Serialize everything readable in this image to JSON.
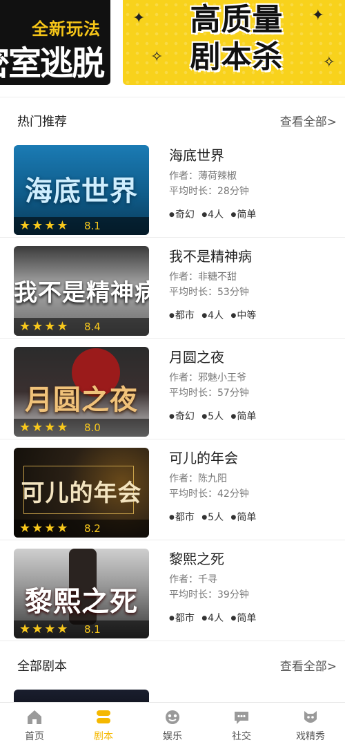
{
  "banners": {
    "left": {
      "line1": "全新玩法",
      "line2": "密室逃脱"
    },
    "right": {
      "line1": "高质量",
      "line2": "剧本杀"
    }
  },
  "sections": {
    "hot": {
      "title": "热门推荐",
      "more": "查看全部>"
    },
    "all": {
      "title": "全部剧本",
      "more": "查看全部>"
    }
  },
  "scripts": [
    {
      "title": "海底世界",
      "cover_title": "海底世界",
      "author": "作者：薄荷辣椒",
      "duration": "平均时长：28分钟",
      "rating": 8.1,
      "score": "8.1",
      "tags": [
        "奇幻",
        "4人",
        "简单"
      ]
    },
    {
      "title": "我不是精神病",
      "cover_title": "我不是精神病",
      "author": "作者：非糖不甜",
      "duration": "平均时长：53分钟",
      "rating": 8.4,
      "score": "8.4",
      "tags": [
        "都市",
        "4人",
        "中等"
      ]
    },
    {
      "title": "月圆之夜",
      "cover_title": "月圆之夜",
      "author": "作者：邪魅小王爷",
      "duration": "平均时长：57分钟",
      "rating": 8.0,
      "score": "8.0",
      "tags": [
        "奇幻",
        "5人",
        "简单"
      ]
    },
    {
      "title": "可儿的年会",
      "cover_title": "可儿的年会",
      "author": "作者：陈九阳",
      "duration": "平均时长：42分钟",
      "rating": 8.2,
      "score": "8.2",
      "tags": [
        "都市",
        "5人",
        "简单"
      ]
    },
    {
      "title": "黎熙之死",
      "cover_title": "黎熙之死",
      "author": "作者：千寻",
      "duration": "平均时长：39分钟",
      "rating": 8.1,
      "score": "8.1",
      "tags": [
        "都市",
        "4人",
        "简单"
      ]
    }
  ],
  "stars": {
    "full": "★★★★",
    "off": ""
  },
  "nav": {
    "items": [
      {
        "label": "首页",
        "icon": "home-icon"
      },
      {
        "label": "剧本",
        "icon": "script-icon",
        "active": true
      },
      {
        "label": "娱乐",
        "icon": "game-icon"
      },
      {
        "label": "社交",
        "icon": "chat-icon"
      },
      {
        "label": "戏精秀",
        "icon": "mask-icon"
      }
    ]
  },
  "colors": {
    "accent": "#f5b800",
    "star": "#f8c81c"
  }
}
